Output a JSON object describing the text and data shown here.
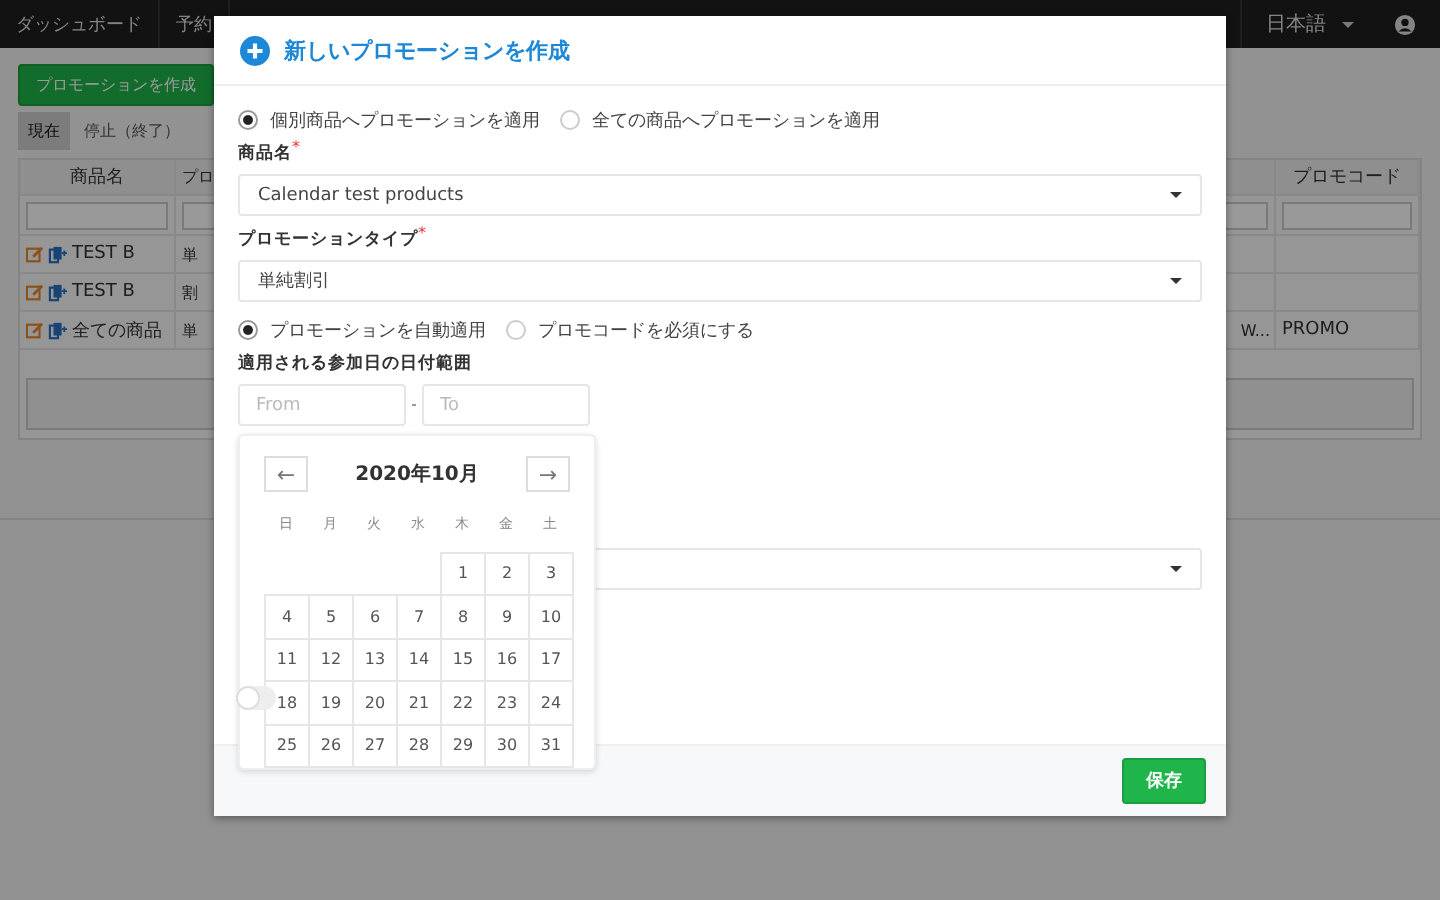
{
  "navbar": {
    "items": [
      "ダッシュボード",
      "予約"
    ],
    "language": "日本語"
  },
  "page": {
    "create_button": "プロモーションを作成",
    "tabs": [
      {
        "label": "現在",
        "selected": true
      },
      {
        "label": "停止（終了）",
        "selected": false
      }
    ],
    "table": {
      "columns": [
        "商品名",
        "プロ",
        "プロモコード"
      ],
      "rows": [
        {
          "name": "TEST B",
          "type": "単"
        },
        {
          "name": "TEST B",
          "type": "割"
        },
        {
          "name": "全ての商品",
          "type": "単",
          "column_3": "W...",
          "code": "PROMO"
        }
      ]
    }
  },
  "modal": {
    "title": "新しいプロモーションを作成",
    "scope_options": [
      {
        "label": "個別商品へプロモーションを適用",
        "selected": true
      },
      {
        "label": "全ての商品へプロモーションを適用",
        "selected": false
      }
    ],
    "product_label": "商品名",
    "product_required_mark": "*",
    "product_value": "Calendar test products",
    "type_label": "プロモーションタイプ",
    "type_required_mark": "*",
    "type_value": "単純割引",
    "apply_options": [
      {
        "label": "プロモーションを自動適用",
        "selected": true
      },
      {
        "label": "プロモコードを必須にする",
        "selected": false
      }
    ],
    "date_label": "適用される参加日の日付範囲",
    "date_from": {
      "placeholder": "From"
    },
    "date_to": {
      "placeholder": "To"
    },
    "toggle": {
      "on": false
    },
    "save_button": "保存"
  },
  "calendar": {
    "prev": "←",
    "next": "→",
    "month": "2020年10月",
    "weekdays": [
      "日",
      "月",
      "火",
      "水",
      "木",
      "金",
      "土"
    ],
    "weeks": [
      {
        "kind": "start",
        "days": [
          "1",
          "2",
          "3"
        ]
      },
      {
        "kind": "full",
        "days": [
          "4",
          "5",
          "6",
          "7",
          "8",
          "9",
          "10"
        ]
      },
      {
        "kind": "full",
        "days": [
          "11",
          "12",
          "13",
          "14",
          "15",
          "16",
          "17"
        ]
      },
      {
        "kind": "full",
        "days": [
          "18",
          "19",
          "20",
          "21",
          "22",
          "23",
          "24"
        ]
      },
      {
        "kind": "full",
        "days": [
          "25",
          "26",
          "27",
          "28",
          "29",
          "30",
          "31"
        ]
      }
    ]
  }
}
